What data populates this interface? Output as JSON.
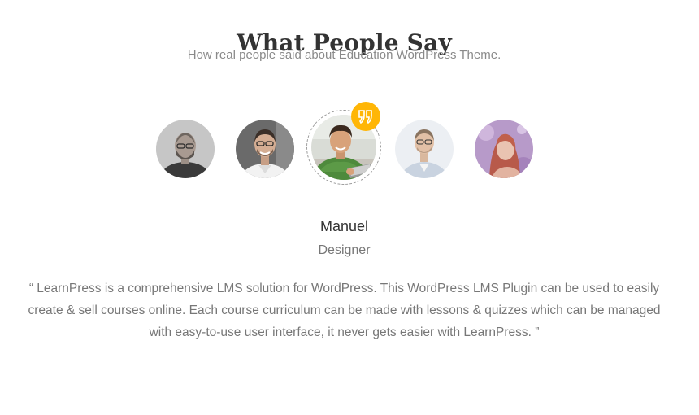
{
  "section": {
    "title": "What People Say",
    "subtitle": "How real people said about Education WordPress Theme."
  },
  "testimonials": [
    {
      "avatar": "man-beard-glasses-photo"
    },
    {
      "avatar": "man-smiling-glasses-photo"
    },
    {
      "avatar": "man-green-shirt-tablet-photo",
      "active": true
    },
    {
      "avatar": "man-glasses-white-shirt-photo"
    },
    {
      "avatar": "woman-purple-background-photo"
    }
  ],
  "active_testimonial": {
    "name": "Manuel",
    "role": "Designer",
    "quote": "“ LearnPress is a comprehensive LMS solution for WordPress. This WordPress LMS Plugin can be used to easily create & sell courses online. Each course curriculum can be made with lessons & quizzes which can be managed with easy-to-use user interface, it never gets easier with LearnPress. ”"
  },
  "colors": {
    "accent": "#ffb606",
    "heading": "#333333",
    "muted": "#777777"
  },
  "icons": {
    "badge": "quote-icon"
  }
}
